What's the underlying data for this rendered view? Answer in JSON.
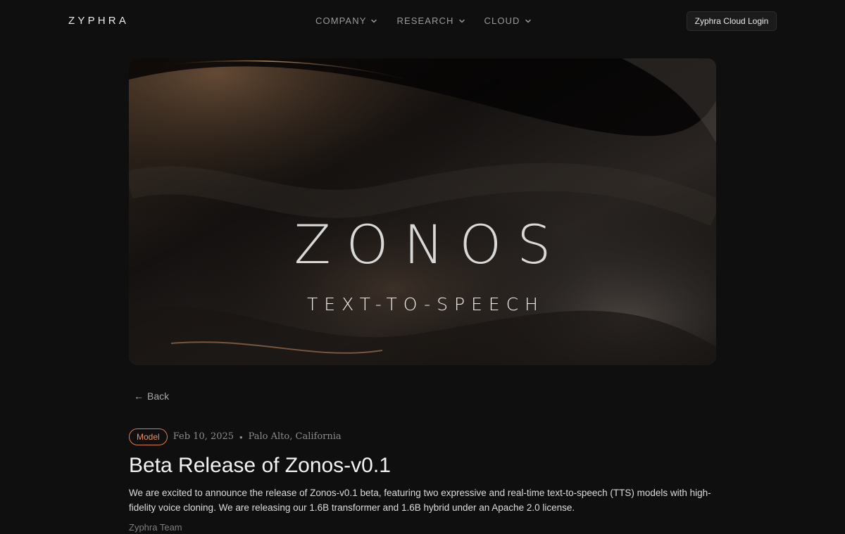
{
  "nav": {
    "logo": "ZYPHRA",
    "items": [
      {
        "label": "COMPANY"
      },
      {
        "label": "RESEARCH"
      },
      {
        "label": "CLOUD"
      }
    ],
    "login_label": "Zyphra Cloud Login"
  },
  "hero": {
    "title": "ZONOS",
    "subtitle": "TEXT-TO-SPEECH"
  },
  "article": {
    "back_label": "Back",
    "badge": "Model",
    "date": "Feb 10, 2025",
    "separator": "•",
    "location": "Palo Alto, California",
    "title": "Beta Release of Zonos-v0.1",
    "intro": "We are excited to announce the release of Zonos-v0.1 beta, featuring two expressive and real-time text-to-speech (TTS) models with high-fidelity voice cloning. We are releasing our 1.6B transformer and 1.6B hybrid under an Apache 2.0 license.",
    "author": "Zyphra Team"
  },
  "colors": {
    "background": "#0f0f0f",
    "accent": "#ee8f5f",
    "nav_text": "#9a9a9a"
  }
}
